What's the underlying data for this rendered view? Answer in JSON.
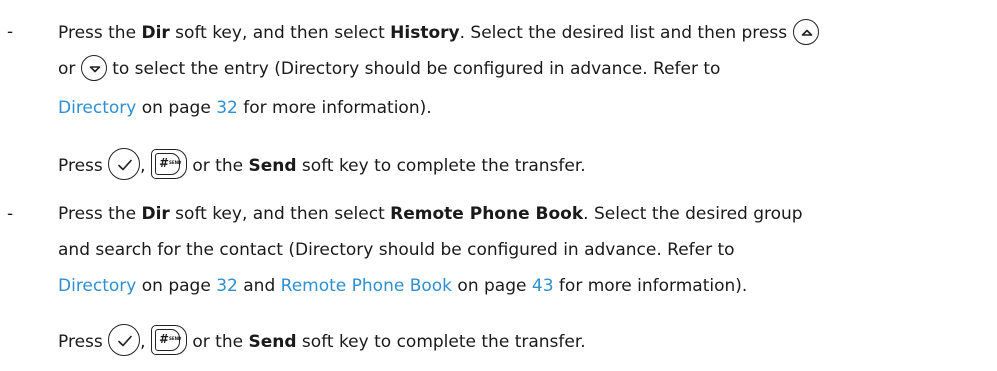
{
  "bullet": "-",
  "history_item": {
    "l1": {
      "t1": "Press the ",
      "b1": "Dir",
      "t2": " soft key, and then select ",
      "b2": "History",
      "t3": ". Select the desired list and then press "
    },
    "l2": {
      "t1": "or ",
      "t2": " to select the entry (Directory should be configured in advance. Refer to"
    },
    "l3": {
      "link1": "Directory",
      "t1": " on page ",
      "page1": "32",
      "t2": " for more information)."
    },
    "l4": {
      "t1": "Press ",
      "t2": ", ",
      "t3": " or the ",
      "b1": "Send",
      "t4": " soft key to complete the transfer."
    }
  },
  "remote_item": {
    "l1": {
      "t1": "Press the ",
      "b1": "Dir",
      "t2": " soft key, and then select ",
      "b2": "Remote Phone Book",
      "t3": ". Select the desired group"
    },
    "l2": {
      "t1": "and search for the contact (Directory should be configured in advance. Refer to"
    },
    "l3": {
      "link1": "Directory",
      "t1": " on page ",
      "page1": "32",
      "t2": " and ",
      "link2": "Remote Phone Book",
      "t3": " on page ",
      "page2": "43",
      "t4": " for more information)."
    },
    "l4": {
      "t1": "Press ",
      "t2": ", ",
      "t3": " or the ",
      "b1": "Send",
      "t4": " soft key to complete the transfer."
    }
  },
  "keys": {
    "up": "up-arrow-key-icon",
    "down": "down-arrow-key-icon",
    "ok": "ok-check-key-icon",
    "send": "send-hash-key-icon",
    "send_glyph": "#",
    "send_sub": "SEND"
  }
}
